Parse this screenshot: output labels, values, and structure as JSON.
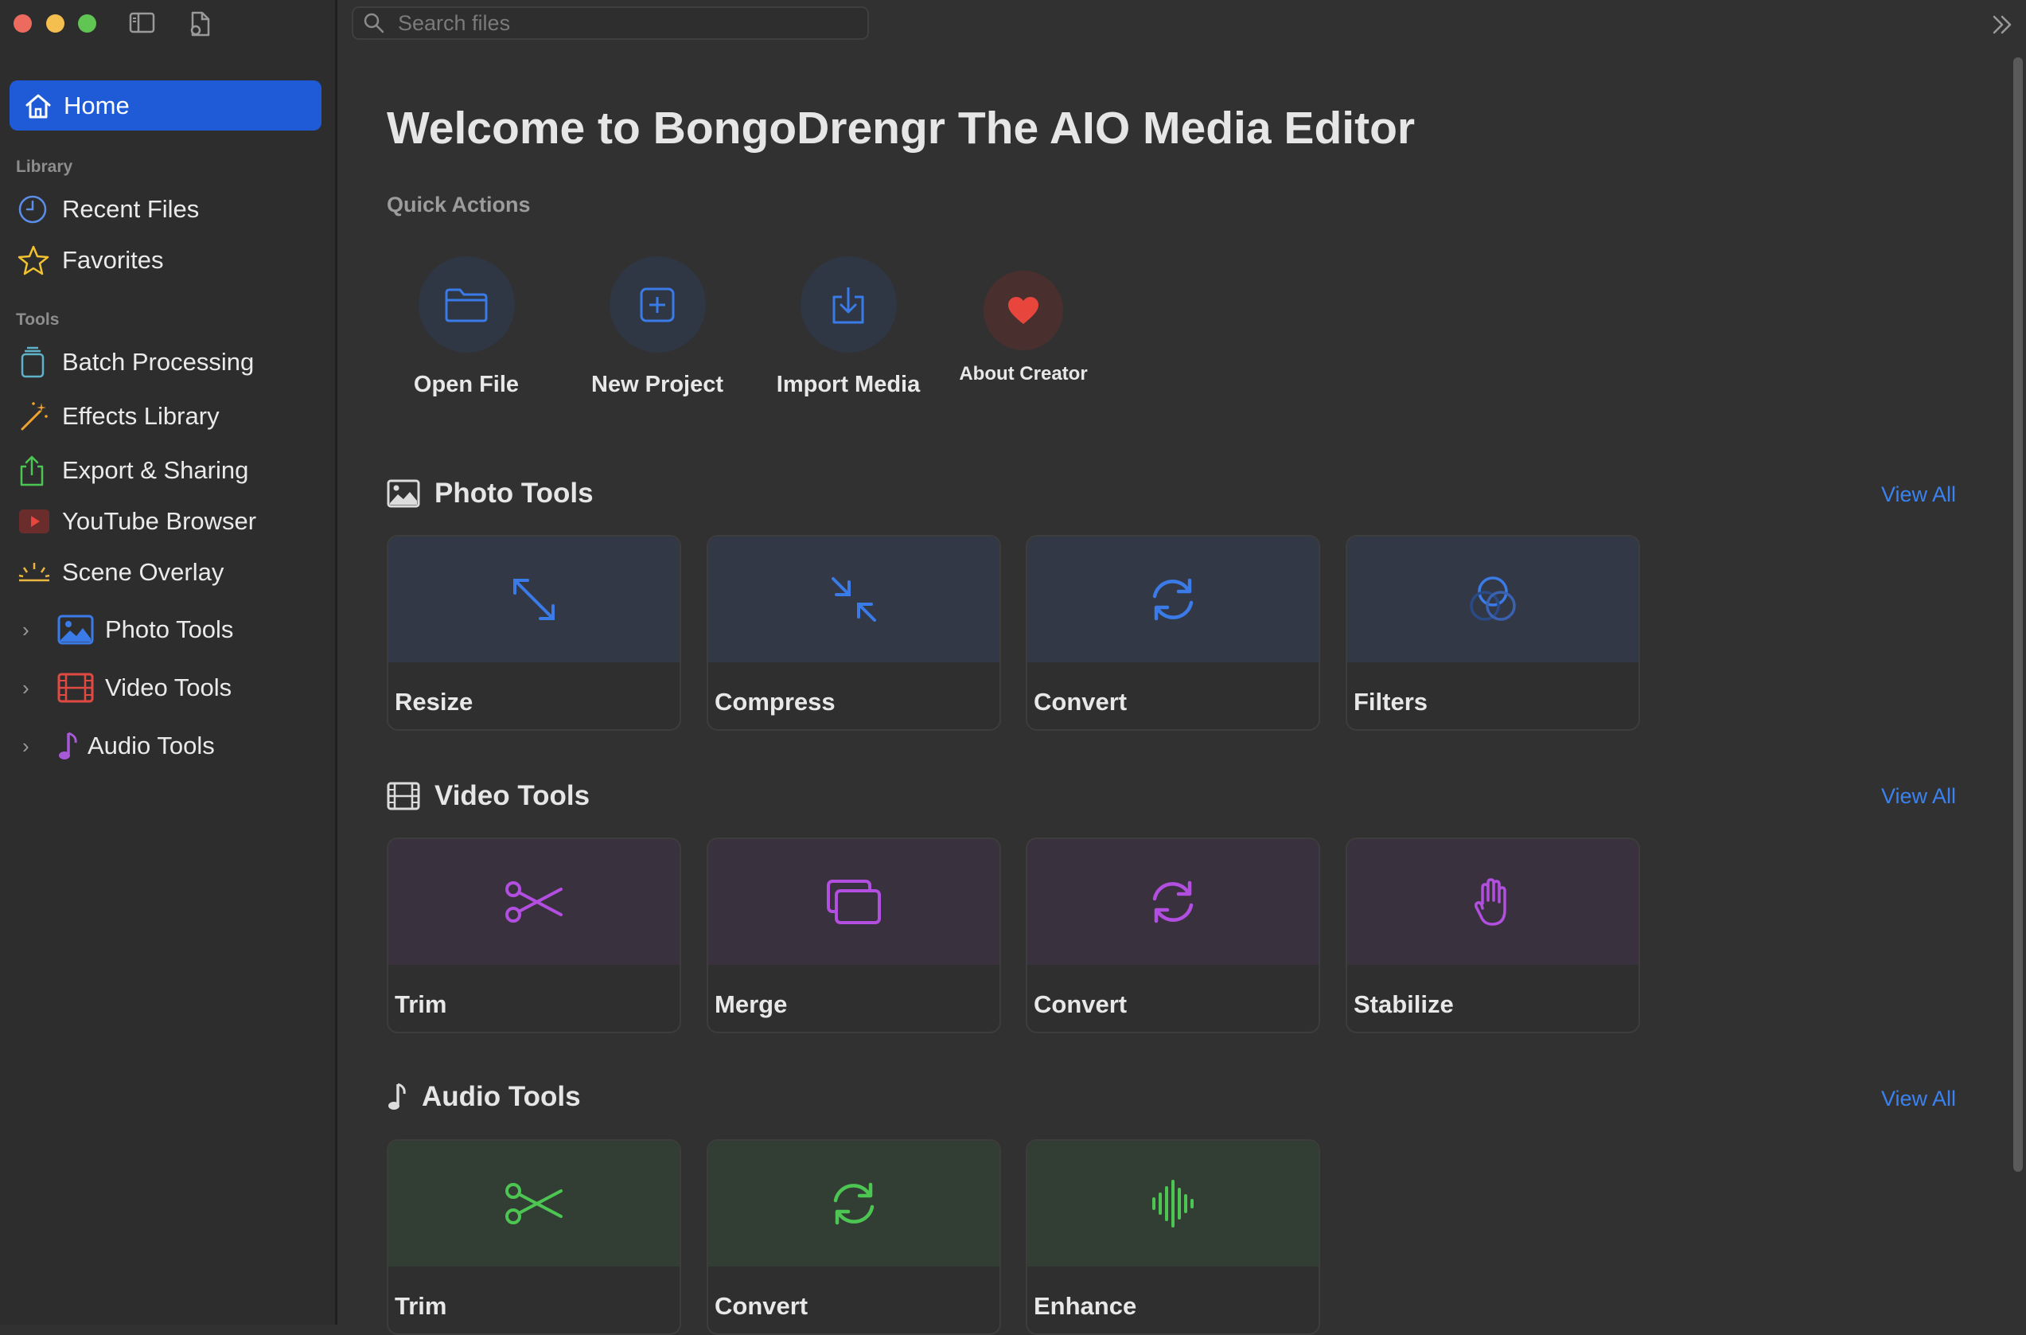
{
  "window": {
    "traffic_lights": [
      "close",
      "minimize",
      "zoom"
    ]
  },
  "sidebar": {
    "home_label": "Home",
    "library_header": "Library",
    "library_items": [
      {
        "label": "Recent Files",
        "icon": "clock-icon"
      },
      {
        "label": "Favorites",
        "icon": "star-icon"
      }
    ],
    "tools_header": "Tools",
    "tools_items": [
      {
        "label": "Batch Processing",
        "icon": "stack-icon"
      },
      {
        "label": "Effects Library",
        "icon": "magic-wand-icon"
      },
      {
        "label": "Export & Sharing",
        "icon": "share-icon"
      },
      {
        "label": "YouTube Browser",
        "icon": "play-icon"
      },
      {
        "label": "Scene Overlay",
        "icon": "sun-horizon-icon"
      }
    ],
    "tree_items": [
      {
        "label": "Photo Tools",
        "icon": "photo-icon"
      },
      {
        "label": "Video Tools",
        "icon": "film-icon"
      },
      {
        "label": "Audio Tools",
        "icon": "music-note-icon"
      }
    ]
  },
  "search": {
    "placeholder": "Search files",
    "value": ""
  },
  "main": {
    "title": "Welcome to BongoDrengr The AIO Media Editor",
    "quick_actions_title": "Quick Actions",
    "quick_actions": [
      {
        "label": "Open File",
        "icon": "folder-icon"
      },
      {
        "label": "New Project",
        "icon": "plus-square-icon"
      },
      {
        "label": "Import Media",
        "icon": "import-icon"
      },
      {
        "label": "About Creator",
        "icon": "heart-icon"
      }
    ],
    "view_all_label": "View All",
    "sections": [
      {
        "title": "Photo Tools",
        "icon": "photo-icon",
        "accent": "#3a7be8",
        "cards": [
          {
            "label": "Resize",
            "icon": "expand-arrows-icon"
          },
          {
            "label": "Compress",
            "icon": "compress-arrows-icon"
          },
          {
            "label": "Convert",
            "icon": "refresh-icon"
          },
          {
            "label": "Filters",
            "icon": "overlapping-circles-icon"
          }
        ]
      },
      {
        "title": "Video Tools",
        "icon": "film-icon",
        "accent": "#b24ee0",
        "cards": [
          {
            "label": "Trim",
            "icon": "scissors-icon"
          },
          {
            "label": "Merge",
            "icon": "stacked-rectangles-icon"
          },
          {
            "label": "Convert",
            "icon": "refresh-icon"
          },
          {
            "label": "Stabilize",
            "icon": "hand-icon"
          }
        ]
      },
      {
        "title": "Audio Tools",
        "icon": "music-note-icon",
        "accent": "#4cc553",
        "cards": [
          {
            "label": "Trim",
            "icon": "scissors-icon"
          },
          {
            "label": "Convert",
            "icon": "refresh-icon"
          },
          {
            "label": "Enhance",
            "icon": "waveform-icon"
          }
        ]
      }
    ]
  },
  "colors": {
    "selection": "#1f5bd6",
    "link": "#3a82f0",
    "heart": "#e8453c"
  }
}
